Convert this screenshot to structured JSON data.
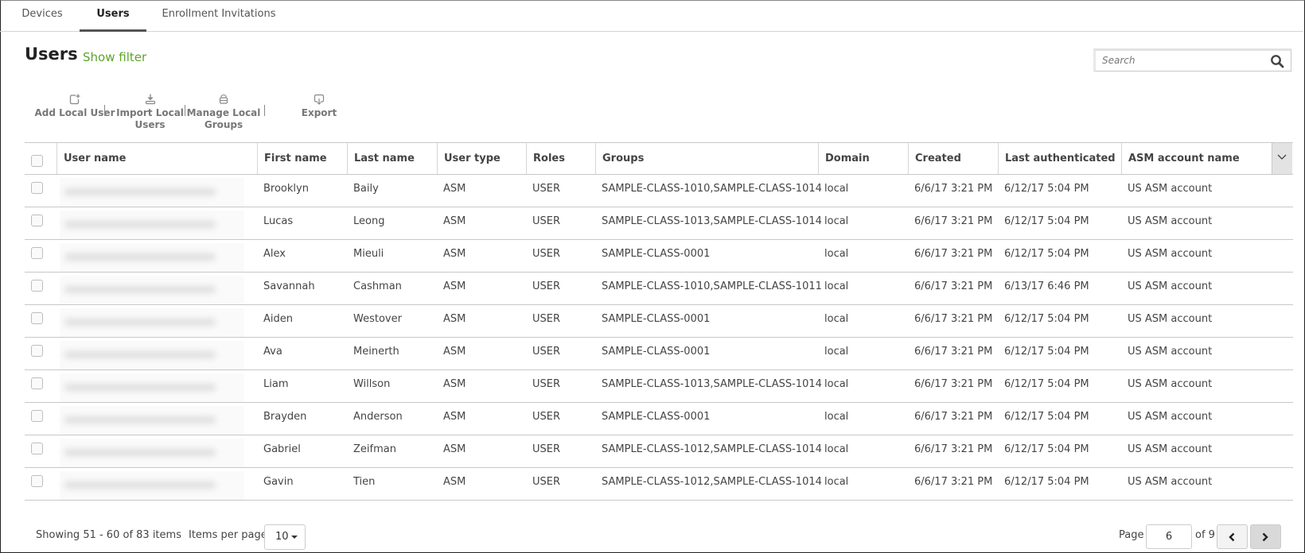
{
  "tabs": [
    {
      "label": "Devices",
      "active": false
    },
    {
      "label": "Users",
      "active": true
    },
    {
      "label": "Enrollment Invitations",
      "active": false
    }
  ],
  "header": {
    "title": "Users",
    "show_filter": "Show filter",
    "search_placeholder": "Search"
  },
  "toolbar": {
    "add_local_user": "Add Local User",
    "import_local_users_line1": "Import Local",
    "import_local_users_line2": "Users",
    "manage_local_groups_line1": "Manage Local",
    "manage_local_groups_line2": "Groups",
    "export": "Export"
  },
  "table": {
    "columns": [
      "User name",
      "First name",
      "Last name",
      "User type",
      "Roles",
      "Groups",
      "Domain",
      "Created",
      "Last authenticated",
      "ASM account name"
    ],
    "rows": [
      {
        "user_name": "[redacted]",
        "first": "Brooklyn",
        "last": "Baily",
        "type": "ASM",
        "roles": "USER",
        "groups": "SAMPLE-CLASS-1010,SAMPLE-CLASS-1014",
        "domain": "local",
        "created": "6/6/17 3:21 PM",
        "last_auth": "6/12/17 5:04 PM",
        "asm": "US ASM account"
      },
      {
        "user_name": "[redacted]",
        "first": "Lucas",
        "last": "Leong",
        "type": "ASM",
        "roles": "USER",
        "groups": "SAMPLE-CLASS-1013,SAMPLE-CLASS-1014",
        "domain": "local",
        "created": "6/6/17 3:21 PM",
        "last_auth": "6/12/17 5:04 PM",
        "asm": "US ASM account"
      },
      {
        "user_name": "[redacted]",
        "first": "Alex",
        "last": "Mieuli",
        "type": "ASM",
        "roles": "USER",
        "groups": "SAMPLE-CLASS-0001",
        "domain": "local",
        "created": "6/6/17 3:21 PM",
        "last_auth": "6/12/17 5:04 PM",
        "asm": "US ASM account"
      },
      {
        "user_name": "[redacted]",
        "first": "Savannah",
        "last": "Cashman",
        "type": "ASM",
        "roles": "USER",
        "groups": "SAMPLE-CLASS-1010,SAMPLE-CLASS-1011",
        "domain": "local",
        "created": "6/6/17 3:21 PM",
        "last_auth": "6/13/17 6:46 PM",
        "asm": "US ASM account"
      },
      {
        "user_name": "[redacted]",
        "first": "Aiden",
        "last": "Westover",
        "type": "ASM",
        "roles": "USER",
        "groups": "SAMPLE-CLASS-0001",
        "domain": "local",
        "created": "6/6/17 3:21 PM",
        "last_auth": "6/12/17 5:04 PM",
        "asm": "US ASM account"
      },
      {
        "user_name": "[redacted]",
        "first": "Ava",
        "last": "Meinerth",
        "type": "ASM",
        "roles": "USER",
        "groups": "SAMPLE-CLASS-0001",
        "domain": "local",
        "created": "6/6/17 3:21 PM",
        "last_auth": "6/12/17 5:04 PM",
        "asm": "US ASM account"
      },
      {
        "user_name": "[redacted]",
        "first": "Liam",
        "last": "Willson",
        "type": "ASM",
        "roles": "USER",
        "groups": "SAMPLE-CLASS-1013,SAMPLE-CLASS-1014",
        "domain": "local",
        "created": "6/6/17 3:21 PM",
        "last_auth": "6/12/17 5:04 PM",
        "asm": "US ASM account"
      },
      {
        "user_name": "[redacted]",
        "first": "Brayden",
        "last": "Anderson",
        "type": "ASM",
        "roles": "USER",
        "groups": "SAMPLE-CLASS-0001",
        "domain": "local",
        "created": "6/6/17 3:21 PM",
        "last_auth": "6/12/17 5:04 PM",
        "asm": "US ASM account"
      },
      {
        "user_name": "[redacted]",
        "first": "Gabriel",
        "last": "Zeifman",
        "type": "ASM",
        "roles": "USER",
        "groups": "SAMPLE-CLASS-1012,SAMPLE-CLASS-1014",
        "domain": "local",
        "created": "6/6/17 3:21 PM",
        "last_auth": "6/12/17 5:04 PM",
        "asm": "US ASM account"
      },
      {
        "user_name": "[redacted]",
        "first": "Gavin",
        "last": "Tien",
        "type": "ASM",
        "roles": "USER",
        "groups": "SAMPLE-CLASS-1012,SAMPLE-CLASS-1014",
        "domain": "local",
        "created": "6/6/17 3:21 PM",
        "last_auth": "6/12/17 5:04 PM",
        "asm": "US ASM account"
      }
    ]
  },
  "footer": {
    "showing": "Showing 51 - 60 of 83 items",
    "items_per_page_label": "Items per page:",
    "items_per_page_value": "10",
    "page_label": "Page",
    "current_page": "6",
    "of_pages": "of 9"
  },
  "colors": {
    "accent_green": "#5ca52a",
    "text": "#444444",
    "border": "#c8c8c8"
  }
}
